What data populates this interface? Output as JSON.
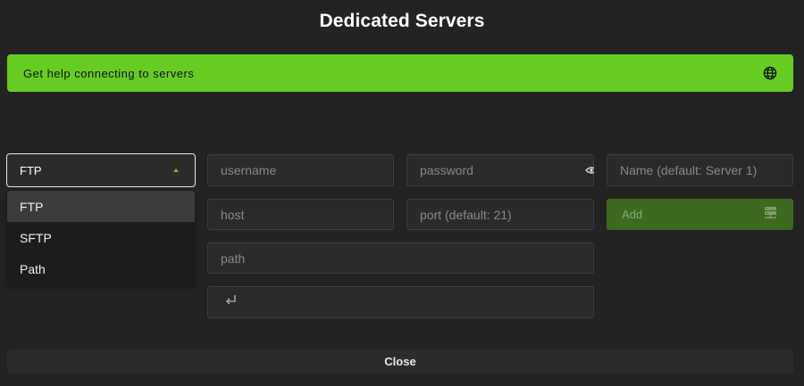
{
  "page": {
    "title": "Dedicated Servers"
  },
  "help_banner": {
    "label": "Get help connecting to servers",
    "icon": "globe-icon",
    "color": "#66cc22"
  },
  "protocol_select": {
    "selected": "FTP",
    "options": [
      "FTP",
      "SFTP",
      "Path"
    ]
  },
  "form": {
    "username_placeholder": "username",
    "password_placeholder": "password",
    "name_placeholder": "Name (default: Server 1)",
    "host_placeholder": "host",
    "port_placeholder": "port (default: 21)",
    "path_placeholder": "path",
    "enter_icon": "return-arrow-icon"
  },
  "actions": {
    "add_label": "Add",
    "add_icon": "server-icon",
    "close_label": "Close"
  },
  "colors": {
    "accent": "#66cc22",
    "add_button": "#3d6a1f",
    "background": "#232323"
  }
}
